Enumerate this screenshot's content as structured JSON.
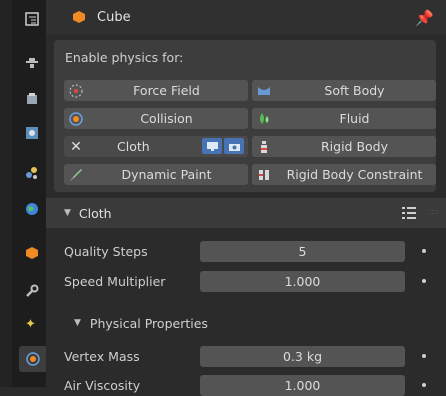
{
  "header": {
    "title": "Cube",
    "pin_icon": "pin-icon",
    "object_icon": "cube-icon"
  },
  "physics": {
    "enable_label": "Enable physics for:",
    "buttons": [
      {
        "label": "Force Field"
      },
      {
        "label": "Soft Body"
      },
      {
        "label": "Collision"
      },
      {
        "label": "Fluid"
      },
      {
        "label": "Cloth",
        "remove_glyph": "✕"
      },
      {
        "label": "Rigid Body"
      },
      {
        "label": "Dynamic Paint"
      },
      {
        "label": "Rigid Body Constraint"
      }
    ]
  },
  "cloth_panel": {
    "title": "Cloth",
    "fields": [
      {
        "label": "Quality Steps",
        "value": "5"
      },
      {
        "label": "Speed Multiplier",
        "value": "1.000"
      }
    ],
    "physical": {
      "title": "Physical Properties",
      "fields": [
        {
          "label": "Vertex Mass",
          "value": "0.3 kg"
        },
        {
          "label": "Air Viscosity",
          "value": "1.000"
        }
      ]
    }
  },
  "colors": {
    "accent": "#4772b3",
    "background": "#2b2b2b",
    "button": "#545454"
  }
}
